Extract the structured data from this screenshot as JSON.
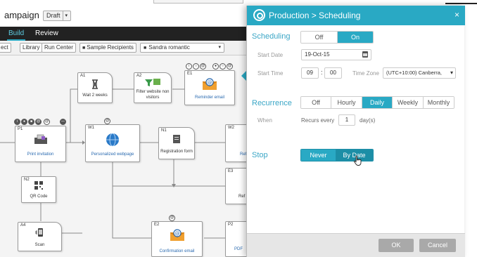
{
  "app": {
    "campaign_title": "ampaign",
    "draft_label": "Draft",
    "draft_arrow": "▾"
  },
  "tabs": [
    {
      "label": "Build",
      "active": true
    },
    {
      "label": "Review",
      "active": false
    }
  ],
  "toolbar": {
    "cut_label": "ect",
    "library_label": "Library",
    "run_center_label": "Run Center",
    "sample_recipients_label": "Sample Recipients",
    "recipient_value": "Sandra romantic",
    "recipient_arrow": "▾"
  },
  "nodes": {
    "a1": {
      "id": "A1",
      "label": "Wait 2 weeks",
      "icon": "hourglass-icon"
    },
    "a2": {
      "id": "A2",
      "label": "Filter website non visitors",
      "icon": "filter-icon"
    },
    "e1": {
      "id": "E1",
      "label": "Reminder email",
      "icon": "email-icon"
    },
    "p1": {
      "id": "P1",
      "label": "Print invitation",
      "icon": "print-icon"
    },
    "w1": {
      "id": "W1",
      "label": "Personalized webpage",
      "icon": "globe-icon"
    },
    "n1": {
      "id": "N1",
      "label": "Registration form",
      "icon": "form-icon"
    },
    "w2": {
      "id": "W2",
      "label": "Ref",
      "icon": "web-icon"
    },
    "n2": {
      "id": "N2",
      "label": "QR Code",
      "icon": "qr-code-icon"
    },
    "e3": {
      "id": "E3",
      "label": "Ref",
      "icon": "email-icon"
    },
    "a4": {
      "id": "A4",
      "label": "Scan",
      "icon": "scan-icon"
    },
    "e2": {
      "id": "E2",
      "label": "Confirmation email",
      "icon": "email-icon"
    },
    "p2": {
      "id": "P2",
      "label": "PDF",
      "icon": "pdf-icon"
    }
  },
  "dialog": {
    "title": "Production > Scheduling",
    "close_glyph": "×",
    "scheduling": {
      "label": "Scheduling",
      "options": [
        "Off",
        "On"
      ],
      "selected": "On",
      "start_date_label": "Start Date",
      "start_date_value": "19-Oct-15",
      "start_time_label": "Start Time",
      "start_hour": "09",
      "start_minute": "00",
      "time_zone_label": "Time Zone",
      "time_zone_value": "(UTC+10:00) Canberra,",
      "time_zone_arrow": "▾"
    },
    "recurrence": {
      "label": "Recurrence",
      "options": [
        "Off",
        "Hourly",
        "Daily",
        "Weekly",
        "Monthly"
      ],
      "selected": "Daily",
      "when_label": "When",
      "recurs_every_label": "Recurs every",
      "recurs_every_value": "1",
      "unit_label": "day(s)"
    },
    "stop": {
      "label": "Stop",
      "options": [
        "Never",
        "By Date"
      ],
      "selected": "By Date"
    },
    "footer": {
      "ok_label": "OK",
      "cancel_label": "Cancel"
    }
  },
  "colors": {
    "accent": "#29a9c4",
    "accent_dark": "#1c8ea6",
    "tab_bar": "#222222",
    "footer_button": "#a9a9a9"
  }
}
